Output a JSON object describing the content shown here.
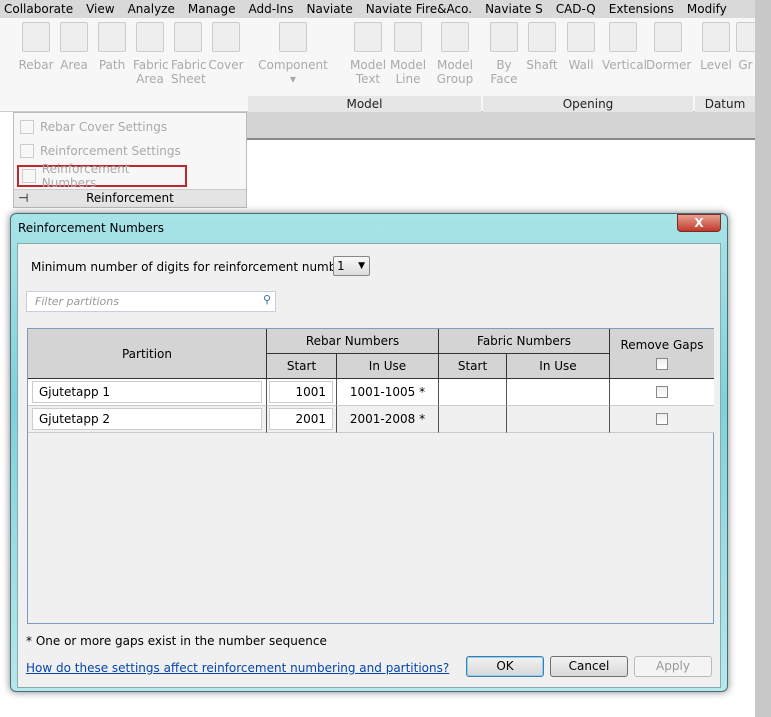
{
  "menubar": [
    "Collaborate",
    "View",
    "Analyze",
    "Manage",
    "Add-Ins",
    "Naviate",
    "Naviate Fire&Aco.",
    "Naviate S",
    "CAD-Q",
    "Extensions",
    "Modify"
  ],
  "ribbon": {
    "reinforcement_buttons": [
      {
        "l1": "Rebar",
        "l2": ""
      },
      {
        "l1": "Area",
        "l2": ""
      },
      {
        "l1": "Path",
        "l2": ""
      },
      {
        "l1": "Fabric",
        "l2": "Area"
      },
      {
        "l1": "Fabric",
        "l2": "Sheet"
      },
      {
        "l1": "Cover",
        "l2": ""
      }
    ],
    "model_buttons": [
      {
        "l1": "Component",
        "l2": "▾"
      },
      {
        "l1": "Model",
        "l2": "Text"
      },
      {
        "l1": "Model",
        "l2": "Line"
      },
      {
        "l1": "Model",
        "l2": "Group"
      }
    ],
    "opening_buttons": [
      {
        "l1": "By",
        "l2": "Face"
      },
      {
        "l1": "Shaft",
        "l2": ""
      },
      {
        "l1": "Wall",
        "l2": ""
      },
      {
        "l1": "Vertical",
        "l2": ""
      },
      {
        "l1": "Dormer",
        "l2": ""
      }
    ],
    "datum_buttons": [
      {
        "l1": "Level",
        "l2": ""
      },
      {
        "l1": "Gr",
        "l2": ""
      }
    ],
    "panels": {
      "model": "Model",
      "opening": "Opening",
      "datum": "Datum",
      "reinforcement": "Reinforcement"
    },
    "dropdown": [
      "Rebar Cover Settings",
      "Reinforcement Settings",
      "Reinforcement Numbers"
    ]
  },
  "dialog": {
    "title": "Reinforcement Numbers",
    "close": "X",
    "digits_label": "Minimum number of digits for reinforcement numbers:",
    "digits_value": "1",
    "filter_placeholder": "Filter partitions",
    "headers": {
      "partition": "Partition",
      "rebar": "Rebar Numbers",
      "fabric": "Fabric Numbers",
      "start": "Start",
      "in_use": "In Use",
      "remove_gaps": "Remove Gaps"
    },
    "rows": [
      {
        "partition": "Gjutetapp 1",
        "rebar_start": "1001",
        "rebar_in_use": "1001-1005 *",
        "fabric_start": "",
        "fabric_in_use": "",
        "remove_gaps": false
      },
      {
        "partition": "Gjutetapp 2",
        "rebar_start": "2001",
        "rebar_in_use": "2001-2008 *",
        "fabric_start": "",
        "fabric_in_use": "",
        "remove_gaps": false
      }
    ],
    "footnote": "* One or more gaps exist in the number sequence",
    "help_link": "How do these settings affect reinforcement numbering and partitions?",
    "ok": "OK",
    "cancel": "Cancel",
    "apply": "Apply"
  }
}
